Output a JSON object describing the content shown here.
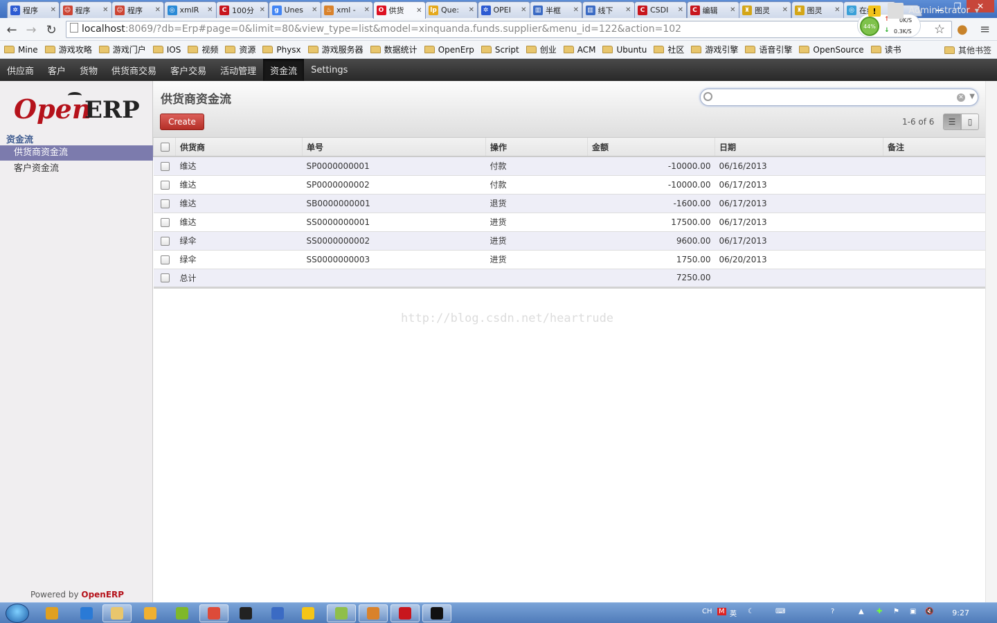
{
  "browser": {
    "tabs": [
      {
        "title": "程序",
        "color": "#2d5bd2",
        "glyph": "✲"
      },
      {
        "title": "程序",
        "color": "#c43",
        "glyph": "☺"
      },
      {
        "title": "程序",
        "color": "#c43",
        "glyph": "☺"
      },
      {
        "title": "xmlR",
        "color": "#2a8ad6",
        "glyph": "◎"
      },
      {
        "title": "100分",
        "color": "#c8161d",
        "glyph": "C"
      },
      {
        "title": "Unes",
        "color": "#4285f4",
        "glyph": "g"
      },
      {
        "title": "xml -",
        "color": "#d9822b",
        "glyph": "♨"
      },
      {
        "title": "供货",
        "color": "#d12",
        "glyph": "O"
      },
      {
        "title": "Que:",
        "color": "#e5a91c",
        "glyph": "lp"
      },
      {
        "title": "OPEI",
        "color": "#2d5bd2",
        "glyph": "✲"
      },
      {
        "title": "半框",
        "color": "#3b6bc4",
        "glyph": "▥"
      },
      {
        "title": "线下",
        "color": "#3b6bc4",
        "glyph": "▥"
      },
      {
        "title": "CSDI",
        "color": "#c8161d",
        "glyph": "C"
      },
      {
        "title": "编辑",
        "color": "#c8161d",
        "glyph": "C"
      },
      {
        "title": "图灵",
        "color": "#d4a617",
        "glyph": "♜"
      },
      {
        "title": "图灵",
        "color": "#d4a617",
        "glyph": "♜"
      },
      {
        "title": "在线",
        "color": "#3aa0d8",
        "glyph": "◎"
      }
    ],
    "url_host": "localhost",
    "url_rest": ":8069/?db=Erp#page=0&limit=80&view_type=list&model=xinquanda.funds.supplier&menu_id=122&action=102",
    "net_percent": "44%",
    "net_up": "0K/S",
    "net_down": "0.3K/S",
    "bookmarks": [
      "Mine",
      "游戏攻略",
      "游戏门户",
      "IOS",
      "视频",
      "资源",
      "Physx",
      "游戏服务器",
      "数据统计",
      "OpenErp",
      "Script",
      "创业",
      "ACM",
      "Ubuntu",
      "社区",
      "游戏引擎",
      "语音引擎",
      "OpenSource",
      "读书"
    ],
    "other_bookmarks": "其他书签"
  },
  "menu": {
    "items": [
      "供应商",
      "客户",
      "货物",
      "供货商交易",
      "客户交易",
      "活动管理",
      "资金流",
      "Settings"
    ],
    "active": "资金流",
    "user": "Administrator"
  },
  "sidebar": {
    "section": "资金流",
    "items": [
      "供货商资金流",
      "客户资金流"
    ],
    "powered_prefix": "Powered by ",
    "powered_brand": "OpenERP"
  },
  "logo": {
    "open": "Open",
    "erp": "ERP"
  },
  "view": {
    "title": "供货商资金流",
    "create_label": "Create",
    "pager": "1-6 of 6",
    "search_value": ""
  },
  "table": {
    "columns": [
      "供货商",
      "单号",
      "操作",
      "金额",
      "日期",
      "备注"
    ],
    "rows": [
      {
        "supplier": "维达",
        "number": "SP0000000001",
        "op": "付款",
        "amount": "-10000.00",
        "date": "06/16/2013",
        "note": ""
      },
      {
        "supplier": "维达",
        "number": "SP0000000002",
        "op": "付款",
        "amount": "-10000.00",
        "date": "06/17/2013",
        "note": ""
      },
      {
        "supplier": "维达",
        "number": "SB0000000001",
        "op": "退货",
        "amount": "-1600.00",
        "date": "06/17/2013",
        "note": ""
      },
      {
        "supplier": "维达",
        "number": "SS0000000001",
        "op": "进货",
        "amount": "17500.00",
        "date": "06/17/2013",
        "note": ""
      },
      {
        "supplier": "绿伞",
        "number": "SS0000000002",
        "op": "进货",
        "amount": "9600.00",
        "date": "06/17/2013",
        "note": ""
      },
      {
        "supplier": "绿伞",
        "number": "SS0000000003",
        "op": "进货",
        "amount": "1750.00",
        "date": "06/20/2013",
        "note": ""
      }
    ],
    "total_label": "总计",
    "total_amount": "7250.00"
  },
  "watermark": "http://blog.csdn.net/heartrude",
  "taskbar": {
    "apps": [
      {
        "name": "media",
        "color": "#e0a020"
      },
      {
        "name": "ie",
        "color": "#2a7ad6"
      },
      {
        "name": "explorer",
        "color": "#e8c66d"
      },
      {
        "name": "mail",
        "color": "#f0b030"
      },
      {
        "name": "torrent",
        "color": "#7fb82a"
      },
      {
        "name": "chrome",
        "color": "#dd4b39"
      },
      {
        "name": "qq",
        "color": "#222"
      },
      {
        "name": "tool",
        "color": "#3b6bc4"
      },
      {
        "name": "sticky",
        "color": "#f5c518"
      },
      {
        "name": "notepad",
        "color": "#8fbf4a"
      },
      {
        "name": "paint",
        "color": "#d9822b"
      },
      {
        "name": "pdf",
        "color": "#c8161d"
      },
      {
        "name": "cmd",
        "color": "#111"
      }
    ],
    "lang": "CH",
    "ime": "英",
    "clock": "9:27"
  }
}
